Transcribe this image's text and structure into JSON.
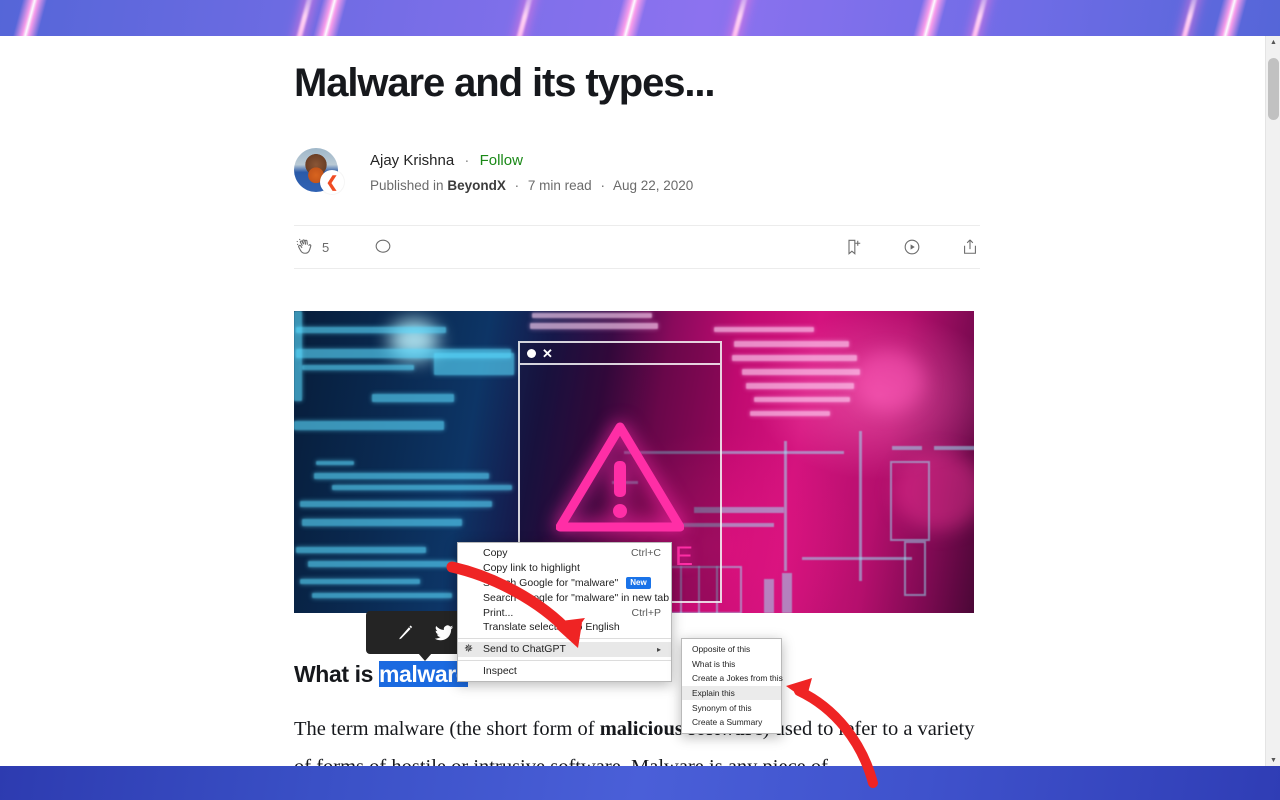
{
  "article": {
    "title": "Malware and its types...",
    "author": "Ajay Krishna",
    "follow_label": "Follow",
    "published_prefix": "Published in",
    "publication": "BeyondX",
    "read_time": "7 min read",
    "date": "Aug 22, 2020",
    "separator": "·",
    "clap_count": "5",
    "section_heading_pre": "What is ",
    "section_heading_selected": "malware",
    "section_heading_post": "?",
    "body_part1": "The term malware (the short form of ",
    "body_bold": "malicious software",
    "body_part2": ") used to refer to a variety of forms of hostile or intrusive software. Malware is any piece of",
    "hero_word": "MALWARE"
  },
  "engagement": {
    "clap_icon": "clap-icon",
    "comment_icon": "comment-icon",
    "bookmark_icon": "bookmark-add-icon",
    "listen_icon": "play-circle-icon",
    "share_icon": "share-icon"
  },
  "highlight_tooltip": {
    "highlight_icon": "pencil-highlight-icon",
    "twitter_icon": "twitter-bird-icon"
  },
  "context_menu": {
    "items": [
      {
        "label": "Copy",
        "accel": "Ctrl+C",
        "badge": "",
        "icon": "",
        "caret": false,
        "selected": false
      },
      {
        "label": "Copy link to highlight",
        "accel": "",
        "badge": "",
        "icon": "",
        "caret": false,
        "selected": false
      },
      {
        "label": "Search Google for \"malware\"",
        "accel": "",
        "badge": "New",
        "icon": "",
        "caret": false,
        "selected": false
      },
      {
        "label": "Search Google for \"malware\" in new tab",
        "accel": "",
        "badge": "",
        "icon": "",
        "caret": false,
        "selected": false
      },
      {
        "label": "Print...",
        "accel": "Ctrl+P",
        "badge": "",
        "icon": "",
        "caret": false,
        "selected": false
      },
      {
        "label": "Translate selection to English",
        "accel": "",
        "badge": "",
        "icon": "",
        "caret": false,
        "selected": false
      }
    ],
    "chatgpt_item": {
      "label": "Send to ChatGPT",
      "icon": "sparkle-icon",
      "caret": "▸"
    },
    "inspect_item": {
      "label": "Inspect"
    }
  },
  "submenu": {
    "items": [
      {
        "label": "Opposite of this",
        "selected": false
      },
      {
        "label": "What is this",
        "selected": false
      },
      {
        "label": "Create a Jokes from this",
        "selected": false
      },
      {
        "label": "Explain this",
        "selected": true
      },
      {
        "label": "Synonym of this",
        "selected": false
      },
      {
        "label": "Create a Summary",
        "selected": false
      }
    ]
  },
  "scrollbar": {
    "up_arrow": "▲",
    "down_arrow": "▼"
  },
  "colors": {
    "follow_green": "#1a8917",
    "selection_blue": "#1b6ae0",
    "badge_blue": "#1a73e8",
    "arrow_red": "#ef2424",
    "menu_bg": "#ffffff"
  }
}
